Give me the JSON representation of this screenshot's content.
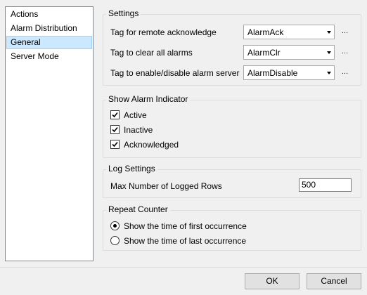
{
  "nav": {
    "items": [
      {
        "label": "Actions"
      },
      {
        "label": "Alarm Distribution"
      },
      {
        "label": "General"
      },
      {
        "label": "Server Mode"
      }
    ],
    "selected": "General"
  },
  "settings": {
    "title": "Settings",
    "rows": [
      {
        "label": "Tag for remote acknowledge",
        "value": "AlarmAck",
        "browse": "…"
      },
      {
        "label": "Tag to clear all alarms",
        "value": "AlarmClr",
        "browse": "…"
      },
      {
        "label": "Tag to enable/disable alarm server",
        "value": "AlarmDisable",
        "browse": "…"
      }
    ]
  },
  "indicator": {
    "title": "Show Alarm Indicator",
    "options": [
      {
        "label": "Active",
        "checked": true
      },
      {
        "label": "Inactive",
        "checked": true
      },
      {
        "label": "Acknowledged",
        "checked": true
      }
    ]
  },
  "log": {
    "title": "Log Settings",
    "label": "Max Number of Logged Rows",
    "value": "500"
  },
  "repeat": {
    "title": "Repeat Counter",
    "options": [
      {
        "label": "Show the time of first occurrence",
        "selected": true
      },
      {
        "label": "Show the time of last occurrence",
        "selected": false
      }
    ]
  },
  "footer": {
    "ok_label": "OK",
    "cancel_label": "Cancel"
  }
}
